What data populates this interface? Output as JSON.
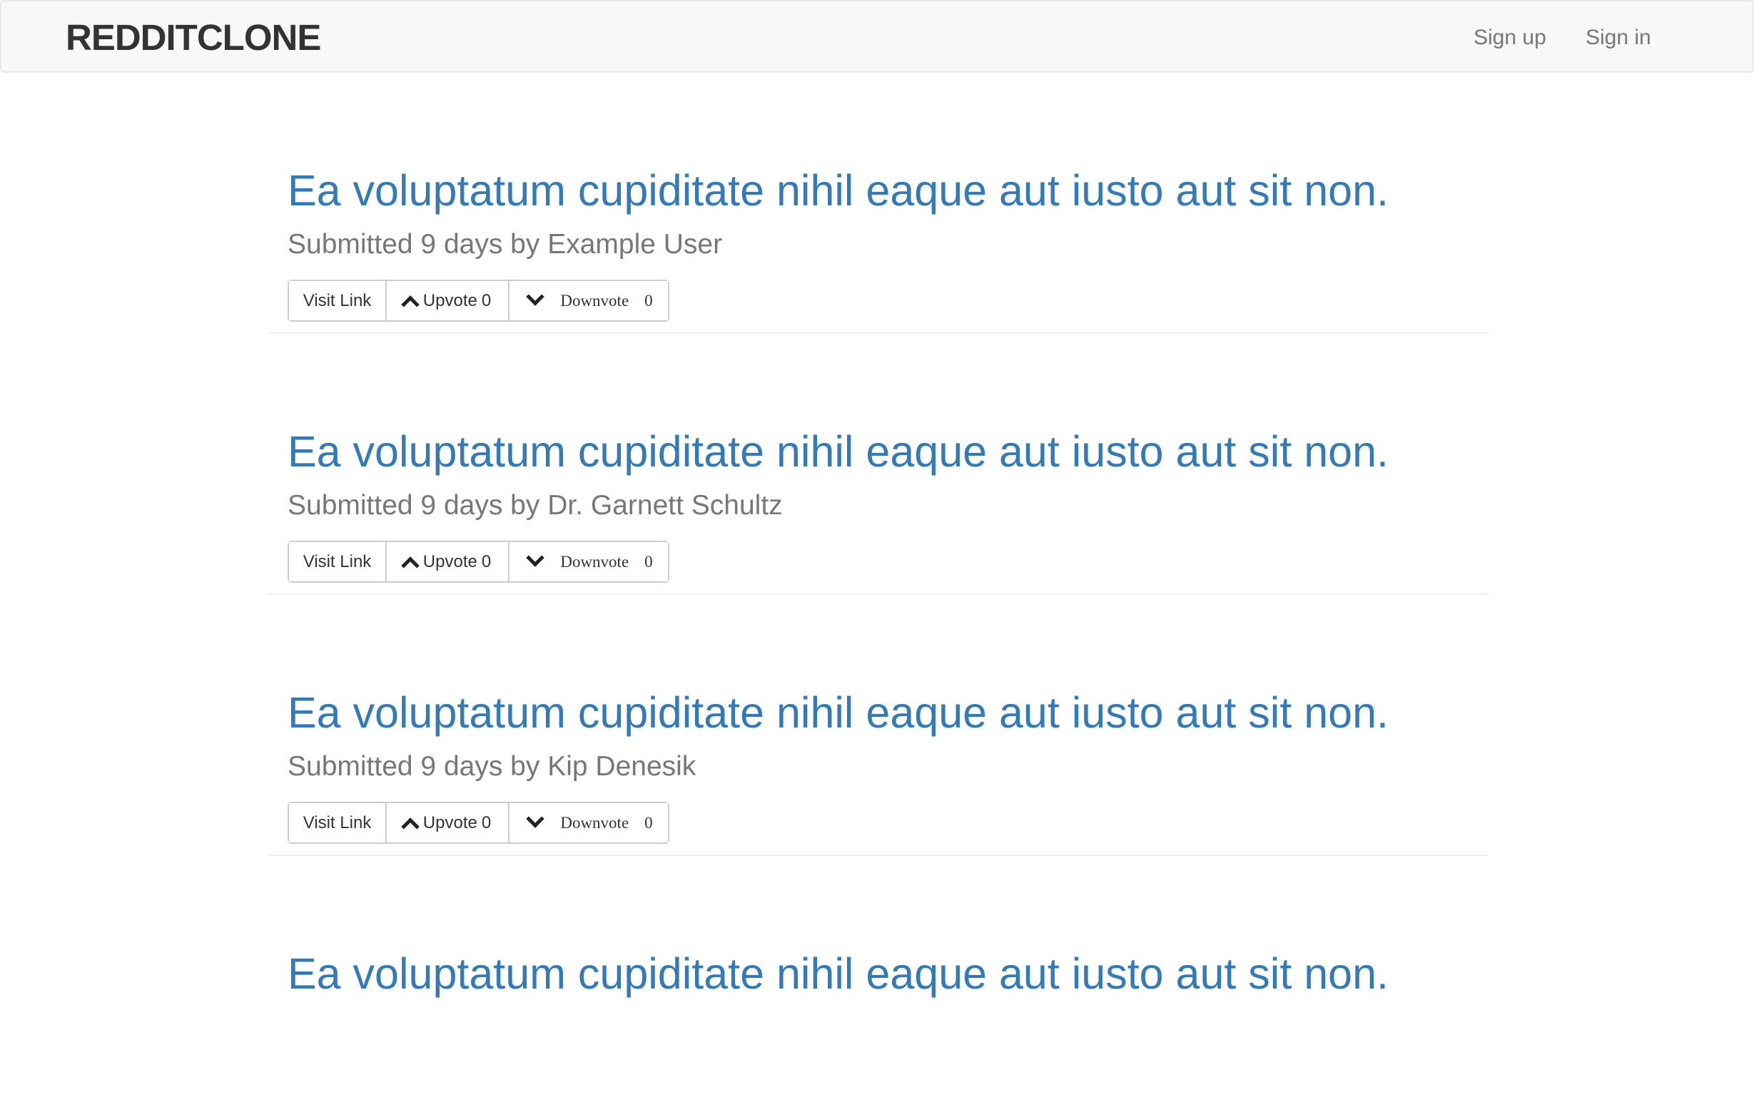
{
  "navbar": {
    "brand": "REDDITCLONE",
    "links": [
      "Sign up",
      "Sign in"
    ]
  },
  "posts": [
    {
      "title": "Ea voluptatum cupiditate nihil eaque aut iusto aut sit non.",
      "meta": "Submitted 9 days by Example User",
      "visit_label": "Visit Link",
      "upvote_label": "Upvote",
      "upvote_count": "0",
      "downvote_label": "Downvote",
      "downvote_count": "0"
    },
    {
      "title": "Ea voluptatum cupiditate nihil eaque aut iusto aut sit non.",
      "meta": "Submitted 9 days by Dr. Garnett Schultz",
      "visit_label": "Visit Link",
      "upvote_label": "Upvote",
      "upvote_count": "0",
      "downvote_label": "Downvote",
      "downvote_count": "0"
    },
    {
      "title": "Ea voluptatum cupiditate nihil eaque aut iusto aut sit non.",
      "meta": "Submitted 9 days by Kip Denesik",
      "visit_label": "Visit Link",
      "upvote_label": "Upvote",
      "upvote_count": "0",
      "downvote_label": "Downvote",
      "downvote_count": "0"
    },
    {
      "title": "Ea voluptatum cupiditate nihil eaque aut iusto aut sit non."
    }
  ],
  "colors": {
    "link": "#337ab7",
    "muted": "#777777",
    "navbar_bg": "#f8f8f8"
  },
  "icons": {
    "upvote": "chevron-up-icon",
    "downvote": "chevron-down-icon"
  }
}
